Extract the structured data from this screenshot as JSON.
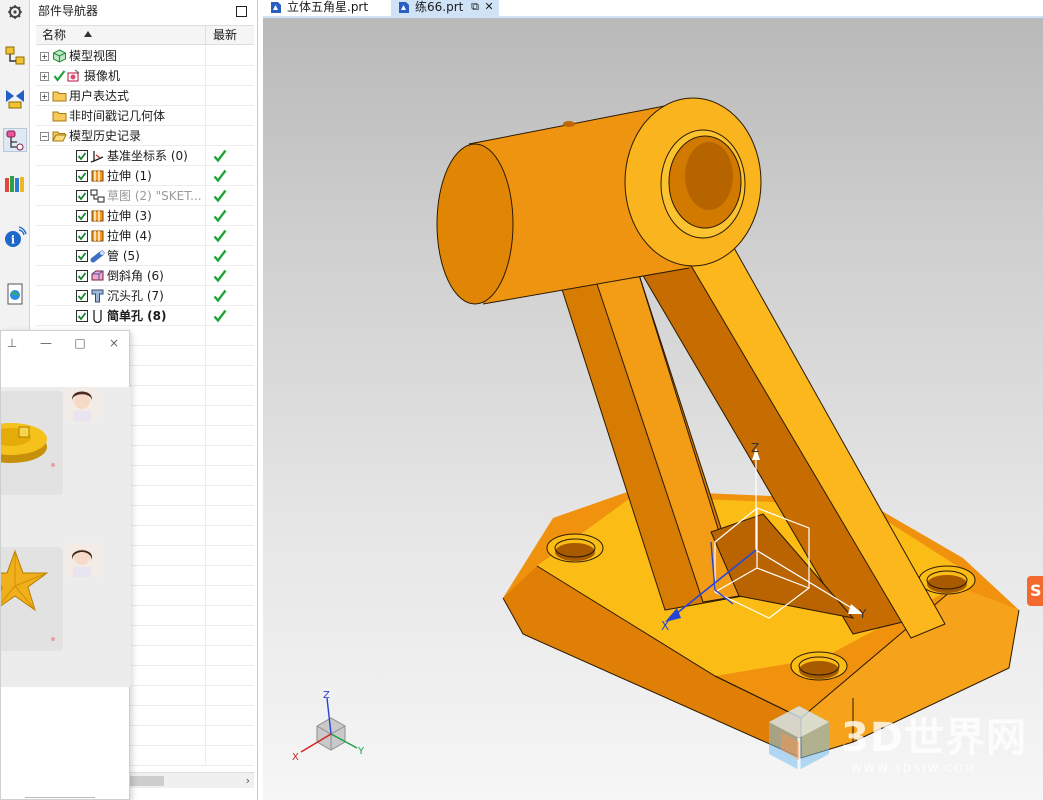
{
  "navigator": {
    "title": "部件导航器",
    "columns": {
      "name": "名称",
      "latest": "最新"
    },
    "rows": [
      {
        "label": "模型视图",
        "icon": "model-views-icon"
      },
      {
        "label": "摄像机",
        "icon": "camera-icon"
      },
      {
        "label": "用户表达式",
        "icon": "folder-icon"
      },
      {
        "label": "非时间戳记几何体",
        "icon": "folder-icon"
      },
      {
        "label": "模型历史记录",
        "icon": "folder-open-icon"
      },
      {
        "label": "基准坐标系 (0)",
        "icon": "datum-csys-icon",
        "latest": "✔"
      },
      {
        "label": "拉伸 (1)",
        "icon": "extrude-icon",
        "latest": "✔"
      },
      {
        "label": "草图 (2) \"SKET...",
        "icon": "sketch-icon",
        "latest": "✔"
      },
      {
        "label": "拉伸 (3)",
        "icon": "extrude-icon",
        "latest": "✔"
      },
      {
        "label": "拉伸 (4)",
        "icon": "extrude-icon",
        "latest": "✔"
      },
      {
        "label": "管 (5)",
        "icon": "tube-icon",
        "latest": "✔"
      },
      {
        "label": "倒斜角 (6)",
        "icon": "chamfer-icon",
        "latest": "✔"
      },
      {
        "label": "沉头孔 (7)",
        "icon": "counterbore-hole-icon",
        "latest": "✔"
      },
      {
        "label": "简单孔 (8)",
        "icon": "simple-hole-icon",
        "latest": "✔"
      }
    ]
  },
  "tabs": [
    {
      "label": "立体五角星.prt",
      "icon": "part-file-icon",
      "active": false
    },
    {
      "label": "练66.prt",
      "icon": "part-file-icon",
      "active": true
    }
  ],
  "popup": {
    "buttons": [
      "⊥",
      "—",
      "□",
      "×"
    ]
  },
  "axes": {
    "x": "X",
    "y": "Y",
    "z": "Z"
  },
  "triad": {
    "x": "X",
    "y": "Y",
    "z": "Z"
  },
  "watermark": {
    "brand": "3D世界网",
    "url": "WWW.3DSJW.COM"
  },
  "colors": {
    "model_light": "#f7a21a",
    "model_mid": "#e08a0a",
    "model_dark": "#bf6d00",
    "check_green": "#22a33a",
    "tab_active": "#cfe2f6"
  }
}
